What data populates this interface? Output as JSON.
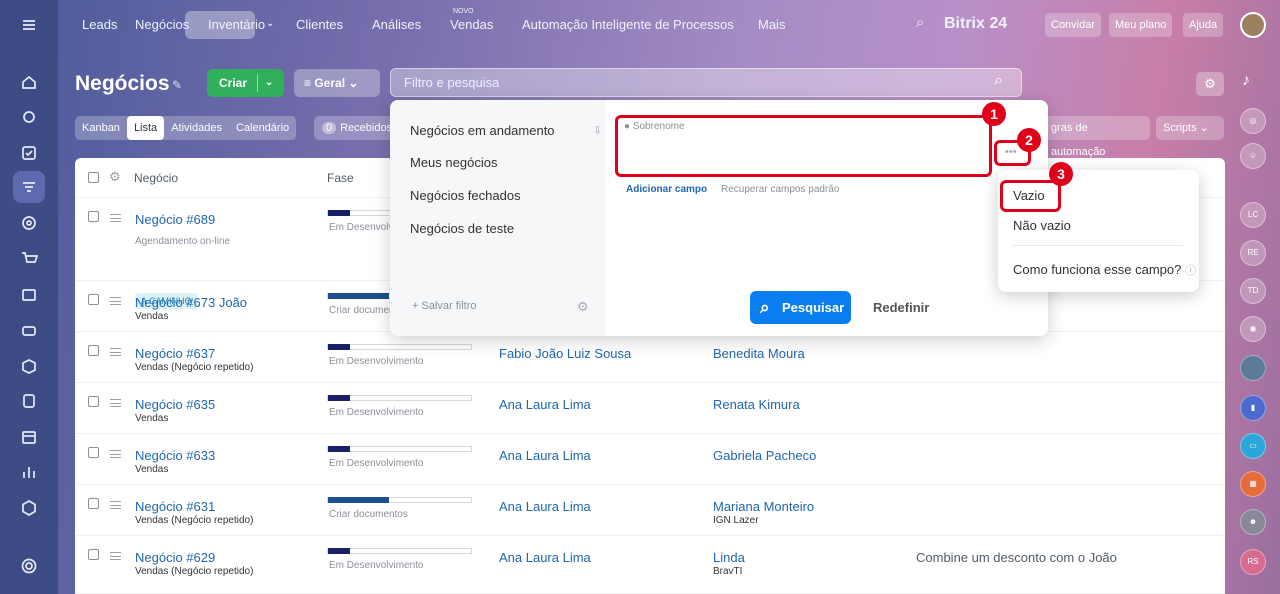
{
  "topnav": {
    "items": [
      "Leads",
      "Negócios",
      "Inventário",
      "Clientes",
      "Análises",
      "Vendas",
      "Automação Inteligente de Processos",
      "Mais"
    ],
    "novo_badge": "NOVO",
    "brand": "Bitrix 24",
    "invite": "Convidar",
    "plan": "Meu plano",
    "help": "Ajuda"
  },
  "page": {
    "title": "Negócios",
    "create": "Criar",
    "filter_preset": "Geral",
    "search_placeholder": "Filtro e pesquisa"
  },
  "views": [
    "Kanban",
    "Lista",
    "Atividades",
    "Calendário"
  ],
  "recebidos": {
    "count": "0",
    "label": "Recebidos"
  },
  "toolbar_right": {
    "automation": "gras de automação",
    "scripts": "Scripts"
  },
  "table": {
    "col_deal": "Negócio",
    "col_stage": "Fase",
    "rows": [
      {
        "deal": "Negócio #689",
        "sub": "Agendamento on-line",
        "tag": "A CAMINHO",
        "stage": "Em Desenvolv",
        "progress": 0.15,
        "contact": "",
        "person": ""
      },
      {
        "deal": "Negócio #673 João",
        "sub": "Vendas",
        "stage": "Criar documen",
        "progress": 0.42,
        "contact": "",
        "person": ""
      },
      {
        "deal": "Negócio #637",
        "sub": "Vendas (Negócio repetido)",
        "stage": "Em Desenvolvimento",
        "progress": 0.15,
        "contact": "Fabio João Luiz Sousa",
        "person": "Benedita Moura"
      },
      {
        "deal": "Negócio #635",
        "sub": "Vendas",
        "stage": "Em Desenvolvimento",
        "progress": 0.15,
        "contact": "Ana Laura Lima",
        "person": "Renata Kimura"
      },
      {
        "deal": "Negócio #633",
        "sub": "Vendas",
        "stage": "Em Desenvolvimento",
        "progress": 0.15,
        "contact": "Ana Laura Lima",
        "person": "Gabriela Pacheco"
      },
      {
        "deal": "Negócio #631",
        "sub": "Vendas (Negócio repetido)",
        "stage": "Criar documentos",
        "progress": 0.42,
        "contact": "Ana Laura Lima",
        "person": "Mariana Monteiro",
        "company": "IGN Lazer"
      },
      {
        "deal": "Negócio #629",
        "sub": "Vendas (Negócio repetido)",
        "stage": "Em Desenvolvimento",
        "progress": 0.15,
        "contact": "Ana Laura Lima",
        "person": "Linda",
        "company": "BravTI",
        "comment": "Combine um desconto com o João"
      }
    ]
  },
  "filter_popup": {
    "presets": [
      "Negócios em andamento",
      "Meus negócios",
      "Negócios fechados",
      "Negócios de teste"
    ],
    "save": "Salvar filtro",
    "field_label": "Sobrenome",
    "add_field": "Adicionar campo",
    "restore": "Recuperar campos padrão",
    "search": "Pesquisar",
    "reset": "Redefinir"
  },
  "field_menu": {
    "items": [
      "Vazio",
      "Não vazio",
      "Como funciona esse campo?"
    ]
  },
  "callouts": [
    "1",
    "2",
    "3"
  ],
  "rightbar": [
    "LC",
    "RE",
    "TD",
    "RS"
  ]
}
